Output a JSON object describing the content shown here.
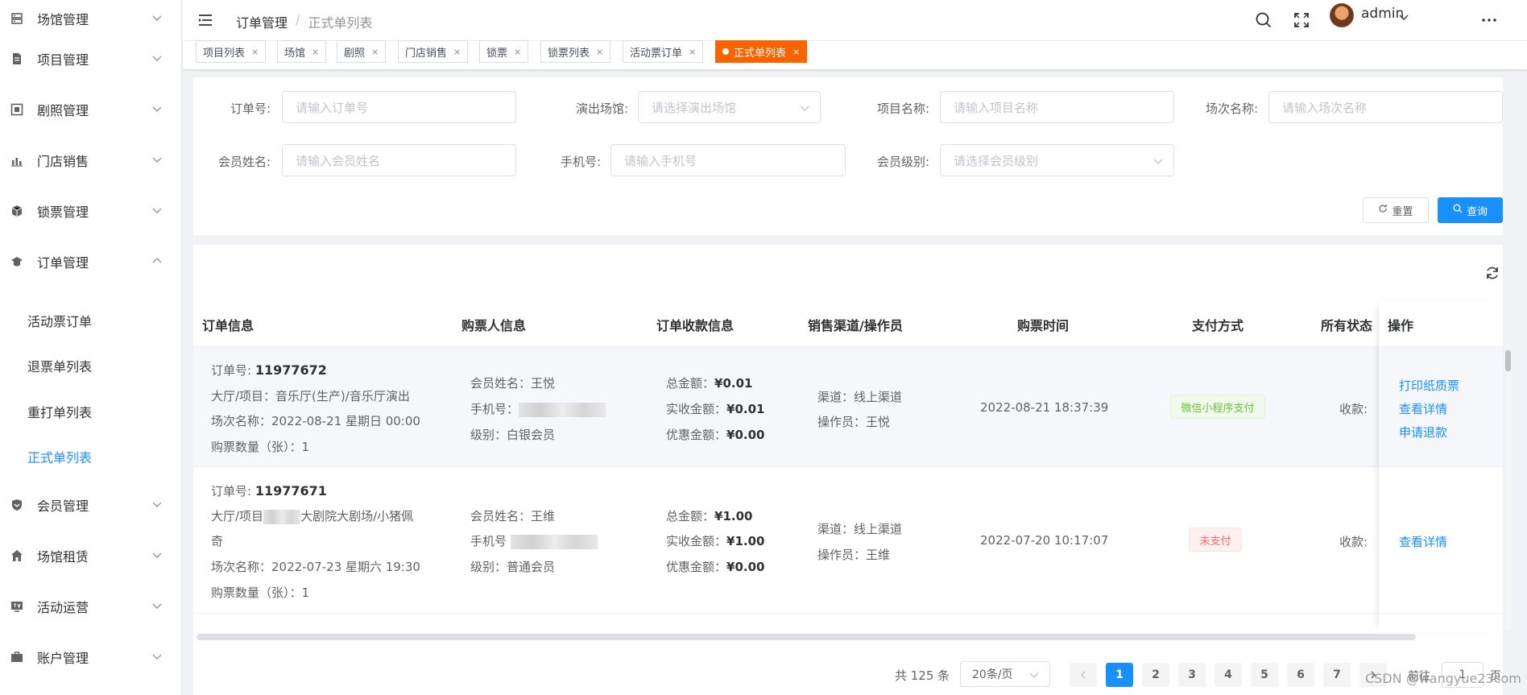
{
  "sidebar": {
    "items": [
      {
        "label": "场馆管理",
        "icon": "building-icon"
      },
      {
        "label": "项目管理",
        "icon": "document-icon"
      },
      {
        "label": "剧照管理",
        "icon": "photo-icon"
      },
      {
        "label": "门店销售",
        "icon": "bar-chart-icon"
      },
      {
        "label": "锁票管理",
        "icon": "box-icon"
      },
      {
        "label": "订单管理",
        "icon": "graduation-cap-icon"
      },
      {
        "label": "会员管理",
        "icon": "shield-icon"
      },
      {
        "label": "场馆租赁",
        "icon": "home-icon"
      },
      {
        "label": "活动运营",
        "icon": "tv-icon"
      },
      {
        "label": "账户管理",
        "icon": "briefcase-icon"
      }
    ],
    "order_submenu": [
      "活动票订单",
      "退票单列表",
      "重打单列表",
      "正式单列表"
    ]
  },
  "header": {
    "breadcrumb_1": "订单管理",
    "breadcrumb_sep": "/",
    "breadcrumb_2": "正式单列表",
    "username": "admin"
  },
  "tags": [
    "项目列表",
    "场馆",
    "剧照",
    "门店销售",
    "锁票",
    "锁票列表",
    "活动票订单",
    "正式单列表"
  ],
  "search": {
    "order_no_label": "订单号:",
    "order_no_placeholder": "请输入订单号",
    "venue_label": "演出场馆:",
    "venue_placeholder": "请选择演出场馆",
    "project_label": "项目名称:",
    "project_placeholder": "请输入项目名称",
    "session_label": "场次名称:",
    "session_placeholder": "请输入场次名称",
    "member_name_label": "会员姓名:",
    "member_name_placeholder": "请输入会员姓名",
    "phone_label": "手机号:",
    "phone_placeholder": "请输入手机号",
    "member_level_label": "会员级别:",
    "member_level_placeholder": "请选择会员级别",
    "reset_label": "重置",
    "query_label": "查询"
  },
  "table": {
    "headers": [
      "订单信息",
      "购票人信息",
      "订单收款信息",
      "销售渠道/操作员",
      "购票时间",
      "支付方式",
      "所有状态",
      "操作"
    ],
    "rows": [
      {
        "order_no_label": "订单号:",
        "order_no": "11977672",
        "hall_project": "大厅/项目：音乐厅(生产)/音乐厅演出",
        "session": "场次名称：2022-08-21 星期日 00:00",
        "quantity": "购票数量（张）：1",
        "member_name": "会员姓名：王悦",
        "phone_label": "手机号：",
        "level": "级别：白银会员",
        "total_label": "总金额：",
        "total": "¥0.01",
        "received_label": "实收金额：",
        "received": "¥0.01",
        "discount_label": "优惠金额：",
        "discount": "¥0.00",
        "channel": "渠道：线上渠道",
        "operator": "操作员：王悦",
        "time": "2022-08-21 18:37:39",
        "payment": "微信小程序支付",
        "status": "收款:",
        "actions": [
          "打印纸质票",
          "查看详情",
          "申请退款"
        ]
      },
      {
        "order_no_label": "订单号:",
        "order_no": "11977671",
        "hall_project_a": "大厅/项目",
        "hall_project_b": "大剧院大剧场/小猪佩",
        "hall_project_c": "奇",
        "session": "场次名称：2022-07-23 星期六 19:30",
        "quantity": "购票数量（张）：1",
        "member_name": "会员姓名：王维",
        "phone_label": "手机号",
        "level": "级别：普通会员",
        "total_label": "总金额：",
        "total": "¥1.00",
        "received_label": "实收金额：",
        "received": "¥1.00",
        "discount_label": "优惠金额：",
        "discount": "¥0.00",
        "channel": "渠道：线上渠道",
        "operator": "操作员：王维",
        "time": "2022-07-20 10:17:07",
        "payment": "未支付",
        "status": "收款:",
        "actions": [
          "查看详情"
        ]
      }
    ]
  },
  "pagination": {
    "total": "共 125 条",
    "page_size": "20条/页",
    "pages": [
      "1",
      "2",
      "3",
      "4",
      "5",
      "6",
      "7"
    ],
    "goto_label": "前往",
    "goto_value": "1",
    "page_suffix": "页"
  },
  "watermark": "CSDN @wangyue23com",
  "colors": {
    "primary": "#1890ff",
    "tag_active": "#fa6400",
    "success": "#67c23a",
    "danger": "#f56c6c"
  }
}
